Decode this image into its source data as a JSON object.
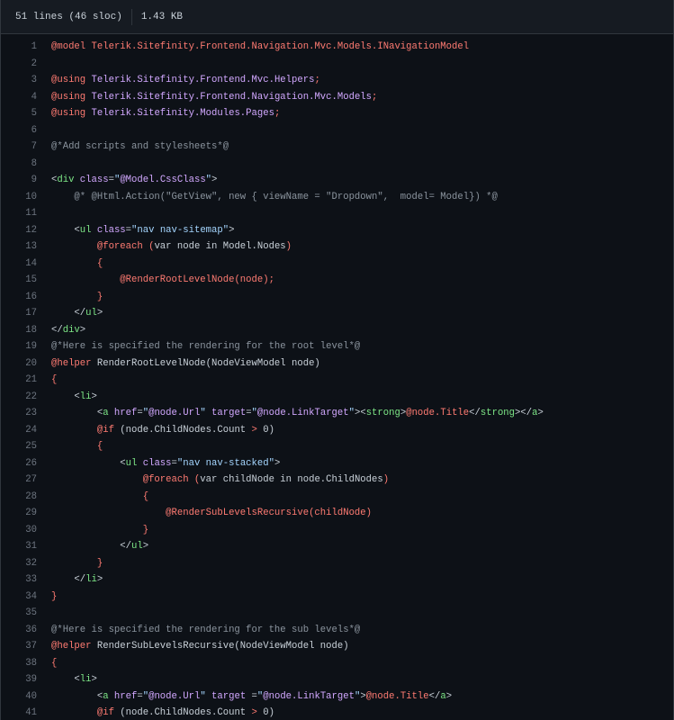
{
  "file_info": {
    "lines": "51 lines (46 sloc)",
    "size": "1.43 KB"
  },
  "code_lines": [
    {
      "n": "1",
      "tokens": [
        {
          "t": "@model ",
          "c": "red"
        },
        {
          "t": "Telerik.Sitefinity.Frontend.Navigation.Mvc.Models.INavigationModel",
          "c": "red"
        }
      ]
    },
    {
      "n": "2",
      "tokens": []
    },
    {
      "n": "3",
      "tokens": [
        {
          "t": "@using ",
          "c": "red"
        },
        {
          "t": "Telerik.Sitefinity.Frontend.Mvc.Helpers",
          "c": "purple"
        },
        {
          "t": ";",
          "c": "red"
        }
      ]
    },
    {
      "n": "4",
      "tokens": [
        {
          "t": "@using ",
          "c": "red"
        },
        {
          "t": "Telerik.Sitefinity.Frontend.Navigation.Mvc.Models",
          "c": "purple"
        },
        {
          "t": ";",
          "c": "red"
        }
      ]
    },
    {
      "n": "5",
      "tokens": [
        {
          "t": "@using ",
          "c": "red"
        },
        {
          "t": "Telerik.Sitefinity.Modules.Pages",
          "c": "purple"
        },
        {
          "t": ";",
          "c": "red"
        }
      ]
    },
    {
      "n": "6",
      "tokens": []
    },
    {
      "n": "7",
      "tokens": [
        {
          "t": "@*Add scripts and stylesheets*@",
          "c": "gray"
        }
      ]
    },
    {
      "n": "8",
      "tokens": []
    },
    {
      "n": "9",
      "tokens": [
        {
          "t": "<",
          "c": "plain"
        },
        {
          "t": "div",
          "c": "green"
        },
        {
          "t": " class",
          "c": "purple"
        },
        {
          "t": "=",
          "c": "plain"
        },
        {
          "t": "\"",
          "c": "blue"
        },
        {
          "t": "@Model.CssClass",
          "c": "purple"
        },
        {
          "t": "\"",
          "c": "blue"
        },
        {
          "t": ">",
          "c": "plain"
        }
      ]
    },
    {
      "n": "10",
      "tokens": [
        {
          "t": "    @* @Html.Action(\"GetView\", new { viewName = \"Dropdown\",  model= Model}) *@",
          "c": "gray"
        }
      ]
    },
    {
      "n": "11",
      "tokens": []
    },
    {
      "n": "12",
      "tokens": [
        {
          "t": "    <",
          "c": "plain"
        },
        {
          "t": "ul",
          "c": "green"
        },
        {
          "t": " class",
          "c": "purple"
        },
        {
          "t": "=",
          "c": "plain"
        },
        {
          "t": "\"nav nav-sitemap\"",
          "c": "blue"
        },
        {
          "t": ">",
          "c": "plain"
        }
      ]
    },
    {
      "n": "13",
      "tokens": [
        {
          "t": "        @foreach",
          "c": "red"
        },
        {
          "t": " (",
          "c": "red"
        },
        {
          "t": "var node in Model.Nodes",
          "c": "plain"
        },
        {
          "t": ")",
          "c": "red"
        }
      ]
    },
    {
      "n": "14",
      "tokens": [
        {
          "t": "        {",
          "c": "red"
        }
      ]
    },
    {
      "n": "15",
      "tokens": [
        {
          "t": "            @RenderRootLevelNode",
          "c": "red"
        },
        {
          "t": "(node);",
          "c": "red"
        }
      ]
    },
    {
      "n": "16",
      "tokens": [
        {
          "t": "        }",
          "c": "red"
        }
      ]
    },
    {
      "n": "17",
      "tokens": [
        {
          "t": "    </",
          "c": "plain"
        },
        {
          "t": "ul",
          "c": "green"
        },
        {
          "t": ">",
          "c": "plain"
        }
      ]
    },
    {
      "n": "18",
      "tokens": [
        {
          "t": "</",
          "c": "plain"
        },
        {
          "t": "div",
          "c": "green"
        },
        {
          "t": ">",
          "c": "plain"
        }
      ]
    },
    {
      "n": "19",
      "tokens": [
        {
          "t": "@*Here is specified the rendering for the root level*@",
          "c": "gray"
        }
      ]
    },
    {
      "n": "20",
      "tokens": [
        {
          "t": "@helper ",
          "c": "red"
        },
        {
          "t": "RenderRootLevelNode(NodeViewModel node)",
          "c": "plain"
        }
      ]
    },
    {
      "n": "21",
      "tokens": [
        {
          "t": "{",
          "c": "red"
        }
      ]
    },
    {
      "n": "22",
      "tokens": [
        {
          "t": "    <",
          "c": "plain"
        },
        {
          "t": "li",
          "c": "green"
        },
        {
          "t": ">",
          "c": "plain"
        }
      ]
    },
    {
      "n": "23",
      "tokens": [
        {
          "t": "        <",
          "c": "plain"
        },
        {
          "t": "a",
          "c": "green"
        },
        {
          "t": " href",
          "c": "purple"
        },
        {
          "t": "=",
          "c": "plain"
        },
        {
          "t": "\"",
          "c": "blue"
        },
        {
          "t": "@node.Url",
          "c": "purple"
        },
        {
          "t": "\"",
          "c": "blue"
        },
        {
          "t": " target",
          "c": "purple"
        },
        {
          "t": "=",
          "c": "plain"
        },
        {
          "t": "\"",
          "c": "blue"
        },
        {
          "t": "@node.LinkTarget",
          "c": "purple"
        },
        {
          "t": "\"",
          "c": "blue"
        },
        {
          "t": "><",
          "c": "plain"
        },
        {
          "t": "strong",
          "c": "green"
        },
        {
          "t": ">",
          "c": "plain"
        },
        {
          "t": "@node.Title",
          "c": "red"
        },
        {
          "t": "</",
          "c": "plain"
        },
        {
          "t": "strong",
          "c": "green"
        },
        {
          "t": "></",
          "c": "plain"
        },
        {
          "t": "a",
          "c": "green"
        },
        {
          "t": ">",
          "c": "plain"
        }
      ]
    },
    {
      "n": "24",
      "tokens": [
        {
          "t": "        @if",
          "c": "red"
        },
        {
          "t": " (",
          "c": "plain"
        },
        {
          "t": "node.ChildNodes.Count ",
          "c": "plain"
        },
        {
          "t": ">",
          "c": "red"
        },
        {
          "t": " 0)",
          "c": "plain"
        }
      ]
    },
    {
      "n": "25",
      "tokens": [
        {
          "t": "        {",
          "c": "red"
        }
      ]
    },
    {
      "n": "26",
      "tokens": [
        {
          "t": "            <",
          "c": "plain"
        },
        {
          "t": "ul",
          "c": "green"
        },
        {
          "t": " class",
          "c": "purple"
        },
        {
          "t": "=",
          "c": "plain"
        },
        {
          "t": "\"nav nav-stacked\"",
          "c": "blue"
        },
        {
          "t": ">",
          "c": "plain"
        }
      ]
    },
    {
      "n": "27",
      "tokens": [
        {
          "t": "                @foreach",
          "c": "red"
        },
        {
          "t": " (",
          "c": "red"
        },
        {
          "t": "var childNode in node.ChildNodes",
          "c": "plain"
        },
        {
          "t": ")",
          "c": "red"
        }
      ]
    },
    {
      "n": "28",
      "tokens": [
        {
          "t": "                {",
          "c": "red"
        }
      ]
    },
    {
      "n": "29",
      "tokens": [
        {
          "t": "                    @RenderSubLevelsRecursive",
          "c": "red"
        },
        {
          "t": "(childNode)",
          "c": "red"
        }
      ]
    },
    {
      "n": "30",
      "tokens": [
        {
          "t": "                }",
          "c": "red"
        }
      ]
    },
    {
      "n": "31",
      "tokens": [
        {
          "t": "            </",
          "c": "plain"
        },
        {
          "t": "ul",
          "c": "green"
        },
        {
          "t": ">",
          "c": "plain"
        }
      ]
    },
    {
      "n": "32",
      "tokens": [
        {
          "t": "        }",
          "c": "red"
        }
      ]
    },
    {
      "n": "33",
      "tokens": [
        {
          "t": "    </",
          "c": "plain"
        },
        {
          "t": "li",
          "c": "green"
        },
        {
          "t": ">",
          "c": "plain"
        }
      ]
    },
    {
      "n": "34",
      "tokens": [
        {
          "t": "}",
          "c": "red"
        }
      ]
    },
    {
      "n": "35",
      "tokens": []
    },
    {
      "n": "36",
      "tokens": [
        {
          "t": "@*Here is specified the rendering for the sub levels*@",
          "c": "gray"
        }
      ]
    },
    {
      "n": "37",
      "tokens": [
        {
          "t": "@helper ",
          "c": "red"
        },
        {
          "t": "RenderSubLevelsRecursive(NodeViewModel node)",
          "c": "plain"
        }
      ]
    },
    {
      "n": "38",
      "tokens": [
        {
          "t": "{",
          "c": "red"
        }
      ]
    },
    {
      "n": "39",
      "tokens": [
        {
          "t": "    <",
          "c": "plain"
        },
        {
          "t": "li",
          "c": "green"
        },
        {
          "t": ">",
          "c": "plain"
        }
      ]
    },
    {
      "n": "40",
      "tokens": [
        {
          "t": "        <",
          "c": "plain"
        },
        {
          "t": "a",
          "c": "green"
        },
        {
          "t": " href",
          "c": "purple"
        },
        {
          "t": "=",
          "c": "plain"
        },
        {
          "t": "\"",
          "c": "blue"
        },
        {
          "t": "@node.Url",
          "c": "purple"
        },
        {
          "t": "\"",
          "c": "blue"
        },
        {
          "t": " target ",
          "c": "purple"
        },
        {
          "t": "=",
          "c": "plain"
        },
        {
          "t": "\"",
          "c": "blue"
        },
        {
          "t": "@node.LinkTarget",
          "c": "purple"
        },
        {
          "t": "\"",
          "c": "blue"
        },
        {
          "t": ">",
          "c": "plain"
        },
        {
          "t": "@node.Title",
          "c": "red"
        },
        {
          "t": "</",
          "c": "plain"
        },
        {
          "t": "a",
          "c": "green"
        },
        {
          "t": ">",
          "c": "plain"
        }
      ]
    },
    {
      "n": "41",
      "tokens": [
        {
          "t": "        @if",
          "c": "red"
        },
        {
          "t": " (",
          "c": "plain"
        },
        {
          "t": "node.ChildNodes.Count ",
          "c": "plain"
        },
        {
          "t": ">",
          "c": "red"
        },
        {
          "t": " 0)",
          "c": "plain"
        }
      ]
    }
  ]
}
